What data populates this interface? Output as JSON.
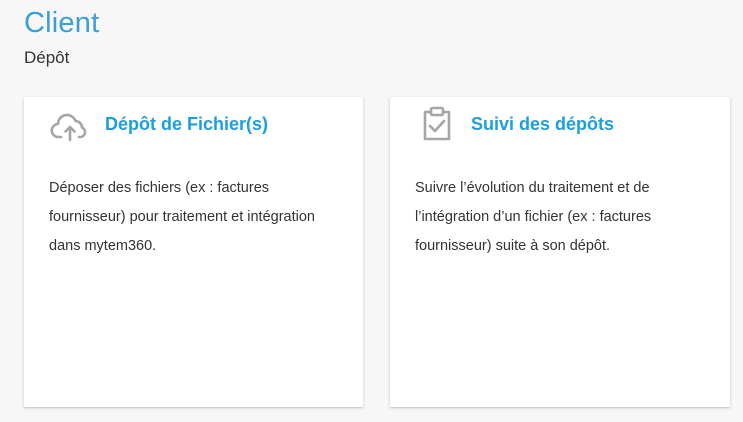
{
  "page": {
    "title": "Client",
    "subtitle": "Dépôt"
  },
  "cards": [
    {
      "icon": "cloud-upload-icon",
      "title": "Dépôt de Fichier(s)",
      "description": "Déposer des fichiers (ex : factures fournisseur) pour traitement et intégration dans mytem360."
    },
    {
      "icon": "clipboard-check-icon",
      "title": "Suivi des dépôts",
      "description": "Suivre l’évolution du traitement et de l’intégration d’un fichier (ex : factures fournisseur) suite à son dépôt."
    }
  ],
  "colors": {
    "title": "#3a9fd6",
    "card_title": "#1a9fe0",
    "icon": "#a6a6a6",
    "background": "#f7f7f7"
  }
}
